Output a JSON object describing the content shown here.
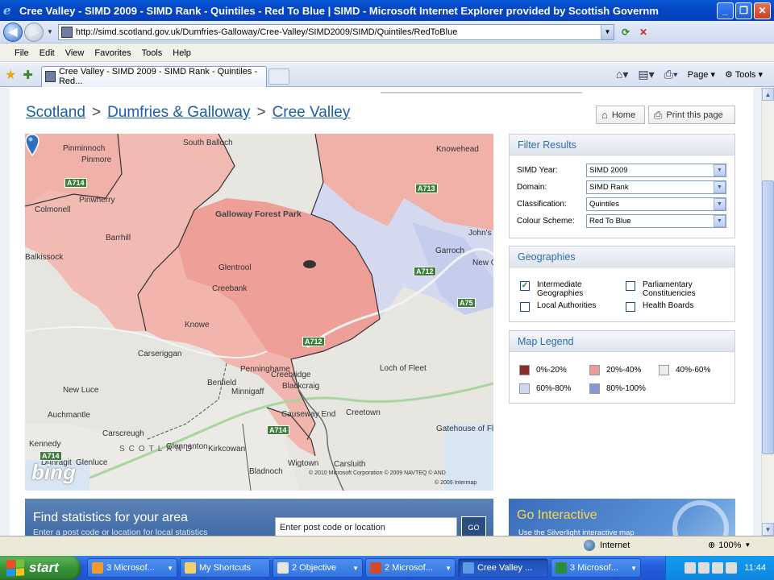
{
  "window": {
    "title": "Cree Valley - SIMD 2009 - SIMD Rank - Quintiles - Red To Blue | SIMD - Microsoft Internet Explorer provided by Scottish Governm"
  },
  "address": {
    "url": "http://simd.scotland.gov.uk/Dumfries-Galloway/Cree-Valley/SIMD2009/SIMD/Quintiles/RedToBlue"
  },
  "menu": [
    "File",
    "Edit",
    "View",
    "Favorites",
    "Tools",
    "Help"
  ],
  "tab": {
    "label": "Cree Valley - SIMD 2009 - SIMD Rank - Quintiles - Red..."
  },
  "commandbar": {
    "page": "Page",
    "tools": "Tools"
  },
  "breadcrumb": {
    "items": [
      "Scotland",
      "Dumfries & Galloway",
      "Cree Valley"
    ],
    "separator": ">"
  },
  "actions": {
    "home": "Home",
    "print": "Print this page"
  },
  "map": {
    "places": [
      "Pinminnoch",
      "Pinmore",
      "South Balloch",
      "Knowehead",
      "Pinwherry",
      "Colmonell",
      "Barrhill",
      "Balkissock",
      "Galloway Forest Park",
      "Garroch",
      "John's To",
      "New Gallo",
      "Glentrool",
      "Creebank",
      "Knowe",
      "Carseriggan",
      "Penninghame",
      "Minnigaff",
      "Creebridge",
      "Blackcraig",
      "New Luce",
      "Benfield",
      "Auchmantle",
      "Glenluce",
      "Carscreugh",
      "Kirkcowan",
      "Causeway End",
      "Creetown",
      "Gatehouse of Flee",
      "Carsluith",
      "Wigtown",
      "Bladnoch",
      "Kennedy",
      "Dunragit",
      "Glennanton",
      "Loch of Fleet"
    ],
    "roads": [
      "A714",
      "A713",
      "A712",
      "A712",
      "A75",
      "A714",
      "A714"
    ],
    "region_text": "SCOTLAND",
    "brand": "bing",
    "copyright": "© 2010 Microsoft Corporation   © 2009 NAVTEQ   © AND",
    "copyright2": "© 2009 Intermap"
  },
  "filter": {
    "title": "Filter Results",
    "rows": [
      {
        "label": "SIMD Year:",
        "value": "SIMD 2009"
      },
      {
        "label": "Domain:",
        "value": "SIMD Rank"
      },
      {
        "label": "Classification:",
        "value": "Quintiles"
      },
      {
        "label": "Colour Scheme:",
        "value": "Red To Blue"
      }
    ]
  },
  "geographies": {
    "title": "Geographies",
    "items": [
      {
        "label": "Intermediate Geographies",
        "checked": true
      },
      {
        "label": "Parliamentary Constituencies",
        "checked": false
      },
      {
        "label": "Local Authorities",
        "checked": false
      },
      {
        "label": "Health Boards",
        "checked": false
      }
    ]
  },
  "legend": {
    "title": "Map Legend",
    "items": [
      {
        "label": "0%-20%",
        "color": "#8b2e28"
      },
      {
        "label": "20%-40%",
        "color": "#eb9c94"
      },
      {
        "label": "40%-60%",
        "color": "#ececec"
      },
      {
        "label": "60%-80%",
        "color": "#cfd6f2"
      },
      {
        "label": "80%-100%",
        "color": "#8797d8"
      }
    ]
  },
  "find": {
    "title": "Find statistics for your area",
    "subtitle": "Enter a post code or location for local statistics",
    "placeholder": "Enter post code or location",
    "go": "GO"
  },
  "interactive": {
    "title": "Go Interactive",
    "subtitle": "Use the Silverlight interactive map"
  },
  "status": {
    "zone": "Internet",
    "zoom": "100%"
  },
  "taskbar": {
    "start": "start",
    "tasks": [
      {
        "label": "3 Microsof...",
        "icon_color": "#f59a2b"
      },
      {
        "label": "My Shortcuts",
        "icon_color": "#f1d36b"
      },
      {
        "label": "2 Objective",
        "icon_color": "#e6e6e6"
      },
      {
        "label": "2 Microsof...",
        "icon_color": "#d34a2a"
      },
      {
        "label": "Cree Valley ...",
        "icon_color": "#5a9be8"
      },
      {
        "label": "3 Microsof...",
        "icon_color": "#2e8b3a"
      }
    ],
    "clock": "11:44"
  }
}
